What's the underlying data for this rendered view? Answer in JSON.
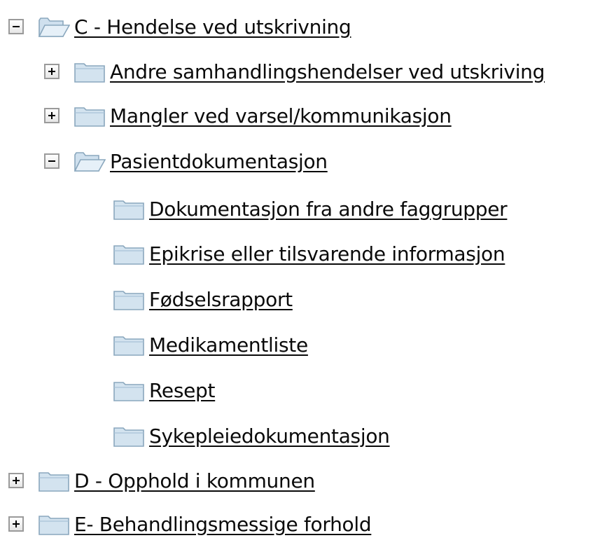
{
  "tree": {
    "nodes": [
      {
        "label": "C - Hendelse ved utskrivning",
        "level": 0,
        "state": "expanded"
      },
      {
        "label": "Andre samhandlingshendelser ved utskriving",
        "level": 1,
        "state": "collapsed"
      },
      {
        "label": "Mangler ved varsel/kommunikasjon",
        "level": 1,
        "state": "collapsed"
      },
      {
        "label": "Pasientdokumentasjon",
        "level": 1,
        "state": "expanded"
      },
      {
        "label": "Dokumentasjon fra andre faggrupper",
        "level": 2,
        "state": "leaf"
      },
      {
        "label": "Epikrise eller tilsvarende informasjon",
        "level": 2,
        "state": "leaf"
      },
      {
        "label": "Fødselsrapport",
        "level": 2,
        "state": "leaf"
      },
      {
        "label": "Medikamentliste",
        "level": 2,
        "state": "leaf"
      },
      {
        "label": "Resept",
        "level": 2,
        "state": "leaf"
      },
      {
        "label": "Sykepleiedokumentasjon",
        "level": 2,
        "state": "leaf"
      },
      {
        "label": "D - Opphold i kommunen",
        "level": 0,
        "state": "collapsed"
      },
      {
        "label": "E- Behandlingsmessige forhold",
        "level": 0,
        "state": "collapsed"
      }
    ]
  }
}
